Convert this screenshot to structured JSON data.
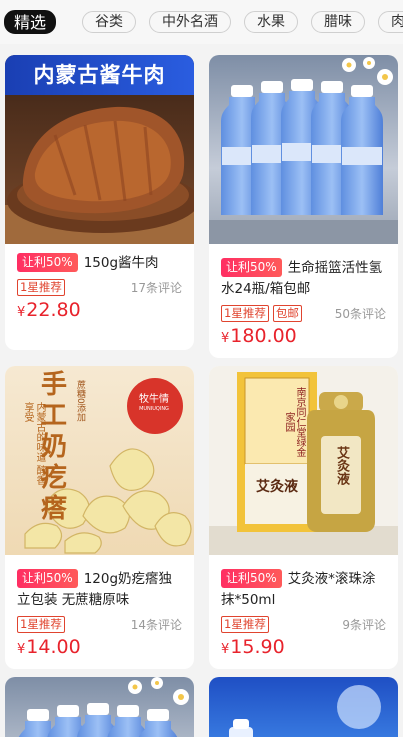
{
  "categories": [
    "精选",
    "谷类",
    "中外名酒",
    "水果",
    "腊味",
    "肉类"
  ],
  "products": [
    {
      "title": "150g酱牛肉",
      "promo_tag": "让利50%",
      "badges": [
        "1星推荐"
      ],
      "comments": "17条评论",
      "price": "22.80",
      "banner_text": "内蒙古酱牛肉"
    },
    {
      "title": "生命摇篮活性氢水24瓶/箱包邮",
      "promo_tag": "让利50%",
      "badges": [
        "1星推荐",
        "包邮"
      ],
      "comments": "50条评论",
      "price": "180.00"
    },
    {
      "title": "120g奶疙瘩独立包装 无蔗糖原味",
      "promo_tag": "让利50%",
      "badges": [
        "1星推荐"
      ],
      "comments": "14条评论",
      "price": "14.00",
      "banner_text": "手工奶疙瘩",
      "side_text": "内蒙古的味道 醇香享受",
      "brand": "牧牛情",
      "brand_en": "MUNIUQING",
      "flavor_label": "蔗糖0添加"
    },
    {
      "title": "艾灸液*滚珠涂抹*50ml",
      "promo_tag": "让利50%",
      "badges": [
        "1星推荐"
      ],
      "comments": "9条评论",
      "price": "15.90",
      "box_top_text": "南京同仁堂绿金家园",
      "box_name": "艾灸液",
      "bottle_name": "艾灸液"
    },
    {
      "title": "",
      "comments": "",
      "price": ""
    },
    {
      "title": "",
      "comments": "",
      "price": ""
    }
  ],
  "currency": "¥"
}
